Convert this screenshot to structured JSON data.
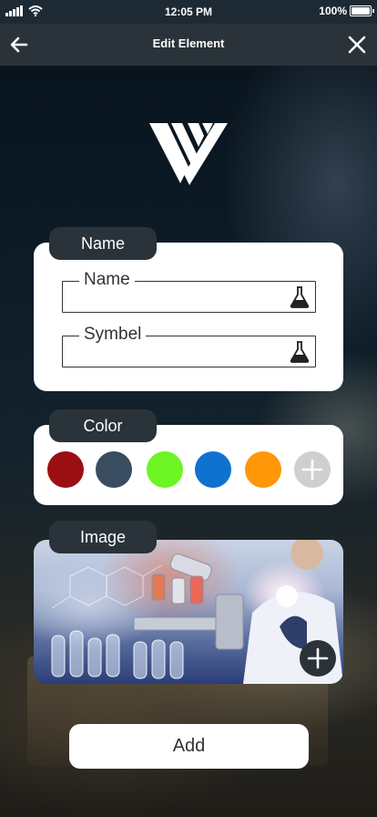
{
  "status_bar": {
    "time": "12:05 PM",
    "battery": "100%",
    "battery_level": 1.0,
    "icons": [
      "signal-icon",
      "wifi-icon",
      "battery-icon"
    ]
  },
  "header": {
    "title": "Edit Element",
    "back_icon": "arrow-left-icon",
    "close_icon": "close-icon"
  },
  "logo": {
    "icon": "brand-logo-v"
  },
  "name_section": {
    "title": "Name",
    "fields": [
      {
        "label": "Name",
        "value": "",
        "icon": "flask-icon"
      },
      {
        "label": "Symbel",
        "value": "",
        "icon": "flask-icon"
      }
    ]
  },
  "color_section": {
    "title": "Color",
    "swatches": [
      "#9b0f13",
      "#3a4c60",
      "#6cf522",
      "#0f72cf",
      "#ff9708"
    ],
    "add_icon": "plus-icon"
  },
  "image_section": {
    "title": "Image",
    "add_icon": "plus-icon"
  },
  "actions": {
    "add_label": "Add"
  }
}
